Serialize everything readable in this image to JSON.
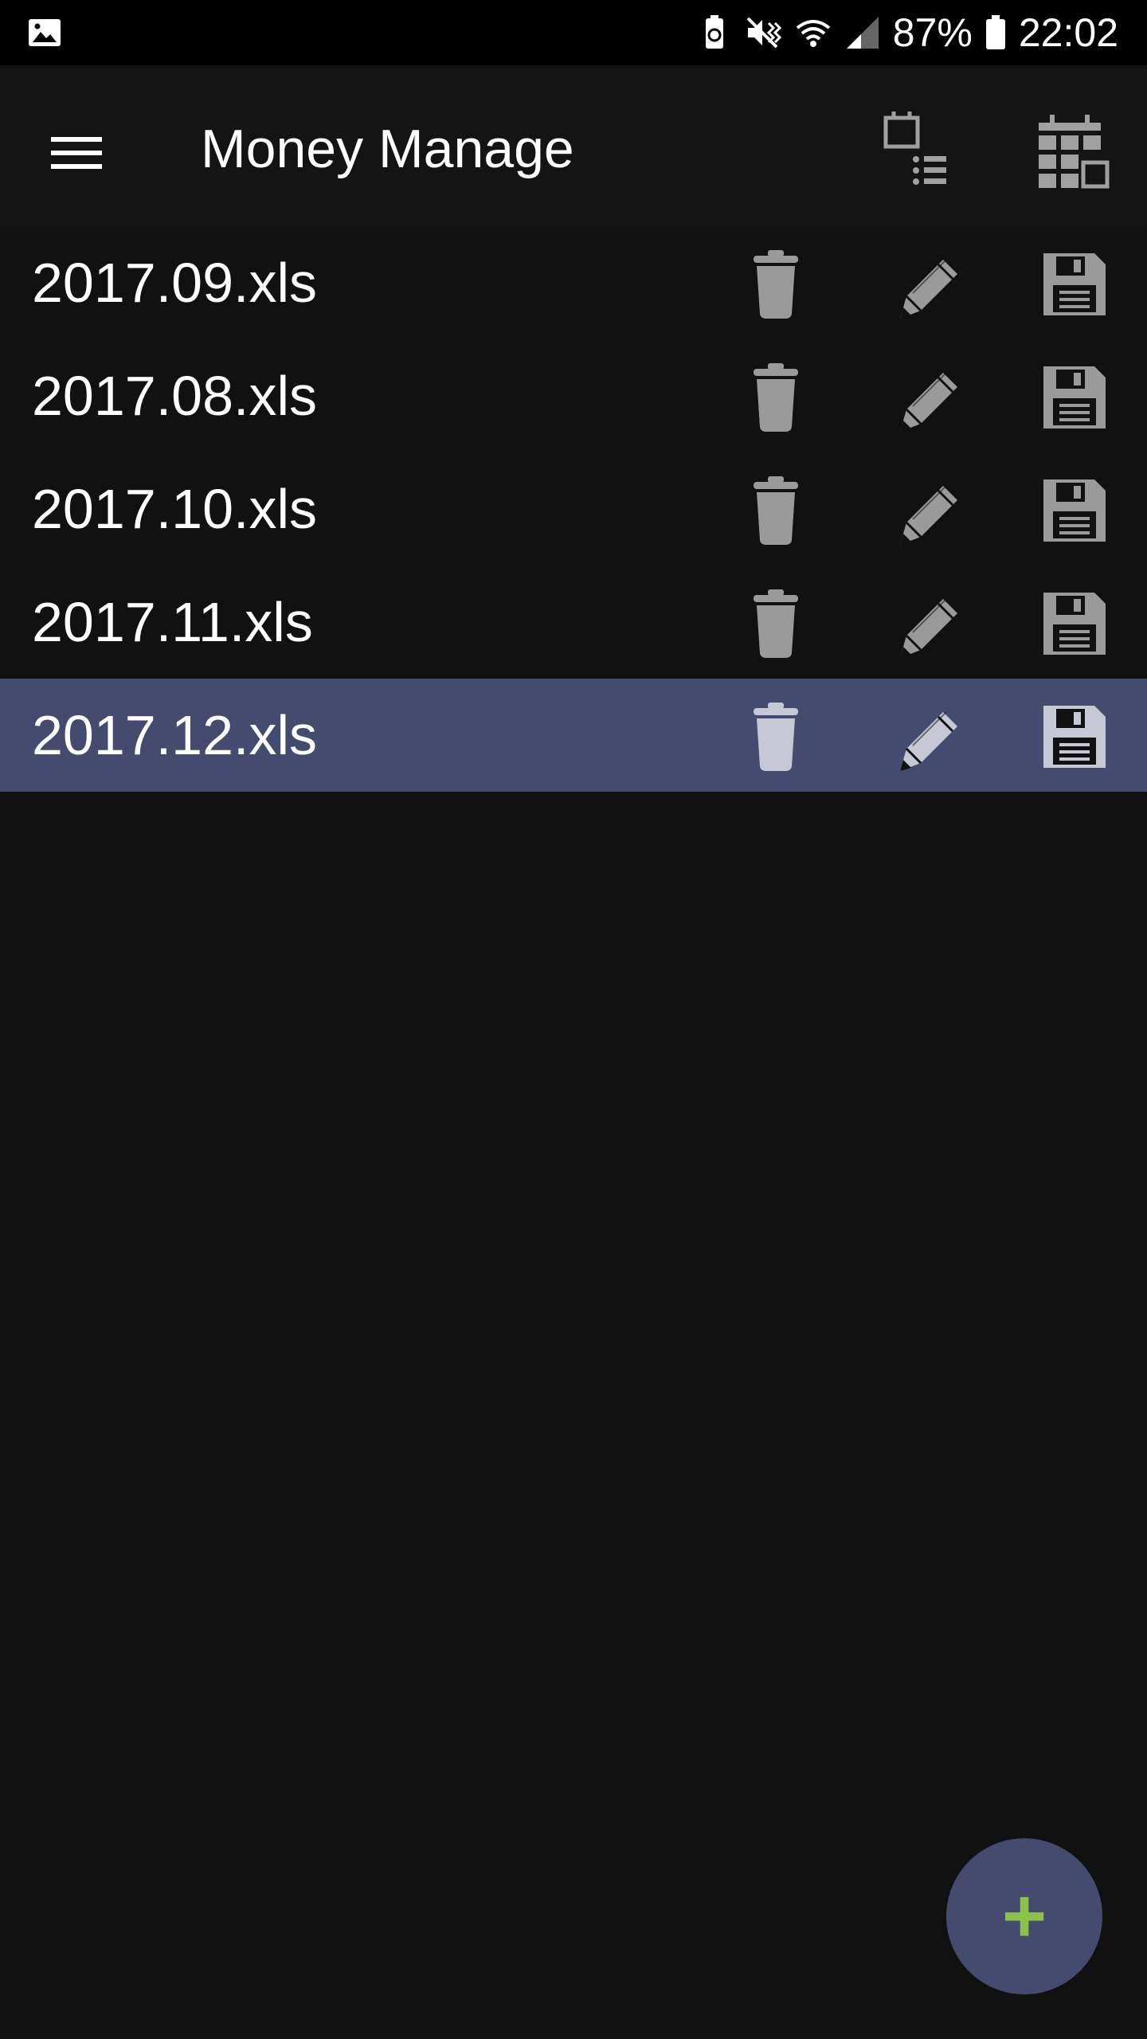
{
  "status_bar": {
    "battery_percent": "87%",
    "time": "22:02",
    "icons": [
      "image-icon",
      "battery-saver-icon",
      "vibrate-icon",
      "wifi-icon",
      "signal-icon",
      "battery-icon"
    ]
  },
  "app_bar": {
    "title": "Money Manage",
    "icons": [
      "menu-icon",
      "calendar-list-icon",
      "calendar-grid-icon"
    ]
  },
  "files": [
    {
      "name": "2017.09.xls",
      "selected": false
    },
    {
      "name": "2017.08.xls",
      "selected": false
    },
    {
      "name": "2017.10.xls",
      "selected": false
    },
    {
      "name": "2017.11.xls",
      "selected": false
    },
    {
      "name": "2017.12.xls",
      "selected": true
    }
  ],
  "row_actions": [
    "trash-icon",
    "pencil-icon",
    "floppy-disk-icon"
  ],
  "fab": {
    "label": "+",
    "icon": "add-icon"
  },
  "colors": {
    "background": "#111111",
    "app_bar": "#141414",
    "selected_row": "#444b6e",
    "icon_gray": "#9a9a9a",
    "selected_icon": "#c6c8d6",
    "fab": "#444b6e",
    "fab_plus": "#8bc34a"
  }
}
